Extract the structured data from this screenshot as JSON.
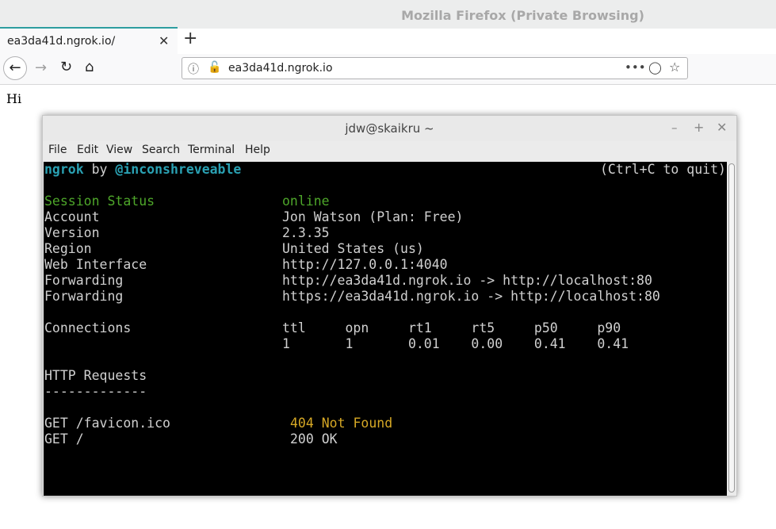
{
  "browser": {
    "window_title": "Mozilla Firefox (Private Browsing)",
    "tab_title": "ea3da41d.ngrok.io/",
    "tab_close": "✕",
    "new_tab": "+",
    "url": "ea3da41d.ngrok.io",
    "url_more": "•••"
  },
  "page": {
    "text": "Hi"
  },
  "terminal": {
    "title": "jdw@skaikru ~",
    "controls": {
      "min": "–",
      "max": "+",
      "close": "✕"
    },
    "menu": [
      "File",
      "Edit",
      "View",
      "Search",
      "Terminal",
      "Help"
    ],
    "header": {
      "app": "ngrok",
      "by": " by ",
      "author": "@inconshreveable",
      "quit": "(Ctrl+C to quit)"
    },
    "session_status": {
      "label": "Session Status",
      "value": "online"
    },
    "rows": [
      {
        "label": "Account",
        "value": "Jon Watson (Plan: Free)"
      },
      {
        "label": "Version",
        "value": "2.3.35"
      },
      {
        "label": "Region",
        "value": "United States (us)"
      },
      {
        "label": "Web Interface",
        "value": "http://127.0.0.1:4040"
      },
      {
        "label": "Forwarding",
        "value": "http://ea3da41d.ngrok.io -> http://localhost:80"
      },
      {
        "label": "Forwarding",
        "value": "https://ea3da41d.ngrok.io -> http://localhost:80"
      }
    ],
    "connections": {
      "label": "Connections",
      "headers": "ttl     opn     rt1     rt5     p50     p90",
      "values": "1       1       0.01    0.00    0.41    0.41"
    },
    "http_requests": {
      "label": "HTTP Requests",
      "divider": "-------------",
      "items": [
        {
          "request": "GET /favicon.ico",
          "status": "404 Not Found"
        },
        {
          "request": "GET /",
          "status": "200 OK"
        }
      ]
    }
  }
}
